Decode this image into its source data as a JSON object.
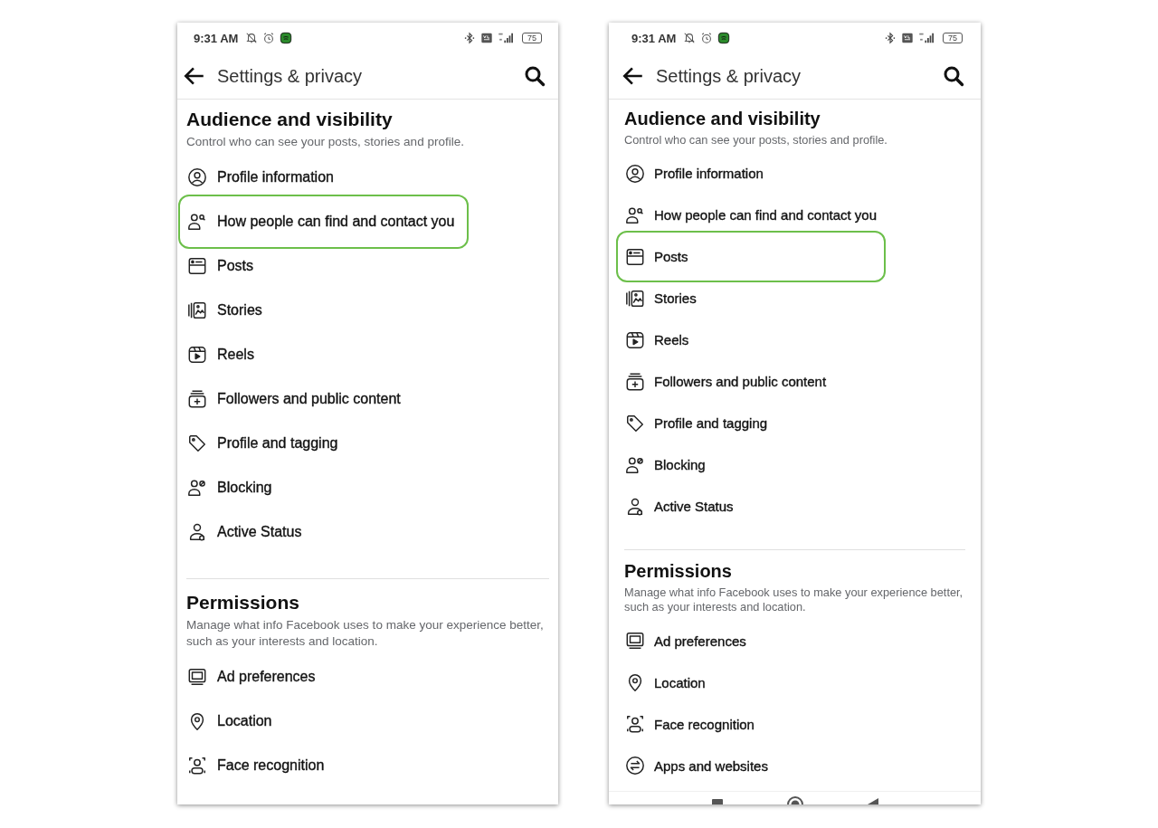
{
  "screens": [
    {
      "status_bar": {
        "time": "9:31 AM",
        "battery": "75"
      },
      "header": {
        "title": "Settings & privacy"
      },
      "sections": [
        {
          "heading": "Audience and visibility",
          "description": "Control who can see your posts, stories and profile.",
          "items": [
            {
              "kind": "profile",
              "label": "Profile information",
              "selected": false
            },
            {
              "kind": "find-people",
              "label": "How people can find and contact you",
              "selected": true
            },
            {
              "kind": "posts",
              "label": "Posts",
              "selected": false
            },
            {
              "kind": "stories",
              "label": "Stories",
              "selected": false
            },
            {
              "kind": "reels",
              "label": "Reels",
              "selected": false
            },
            {
              "kind": "followers",
              "label": "Followers and public content",
              "selected": false
            },
            {
              "kind": "tag",
              "label": "Profile and tagging",
              "selected": false
            },
            {
              "kind": "blocking",
              "label": "Blocking",
              "selected": false
            },
            {
              "kind": "active",
              "label": "Active Status",
              "selected": false
            }
          ]
        },
        {
          "heading": "Permissions",
          "description": "Manage what info Facebook uses to make your experience better, such as your interests and location.",
          "items": [
            {
              "kind": "ad",
              "label": "Ad preferences",
              "selected": false
            },
            {
              "kind": "location",
              "label": "Location",
              "selected": false
            },
            {
              "kind": "face",
              "label": "Face recognition",
              "selected": false
            }
          ]
        }
      ],
      "nav_bar": false
    },
    {
      "status_bar": {
        "time": "9:31 AM",
        "battery": "75"
      },
      "header": {
        "title": "Settings & privacy"
      },
      "sections": [
        {
          "heading": "Audience and visibility",
          "description": "Control who can see your posts, stories and profile.",
          "items": [
            {
              "kind": "profile",
              "label": "Profile information",
              "selected": false
            },
            {
              "kind": "find-people",
              "label": "How people can find and contact you",
              "selected": false
            },
            {
              "kind": "posts",
              "label": "Posts",
              "selected": true
            },
            {
              "kind": "stories",
              "label": "Stories",
              "selected": false
            },
            {
              "kind": "reels",
              "label": "Reels",
              "selected": false
            },
            {
              "kind": "followers",
              "label": "Followers and public content",
              "selected": false
            },
            {
              "kind": "tag",
              "label": "Profile and tagging",
              "selected": false
            },
            {
              "kind": "blocking",
              "label": "Blocking",
              "selected": false
            },
            {
              "kind": "active",
              "label": "Active Status",
              "selected": false
            }
          ]
        },
        {
          "heading": "Permissions",
          "description": "Manage what info Facebook uses to make your experience better, such as your interests and location.",
          "items": [
            {
              "kind": "ad",
              "label": "Ad preferences",
              "selected": false
            },
            {
              "kind": "location",
              "label": "Location",
              "selected": false
            },
            {
              "kind": "face",
              "label": "Face recognition",
              "selected": false
            },
            {
              "kind": "apps",
              "label": "Apps and websites",
              "selected": false
            }
          ]
        }
      ],
      "nav_bar": true
    }
  ]
}
